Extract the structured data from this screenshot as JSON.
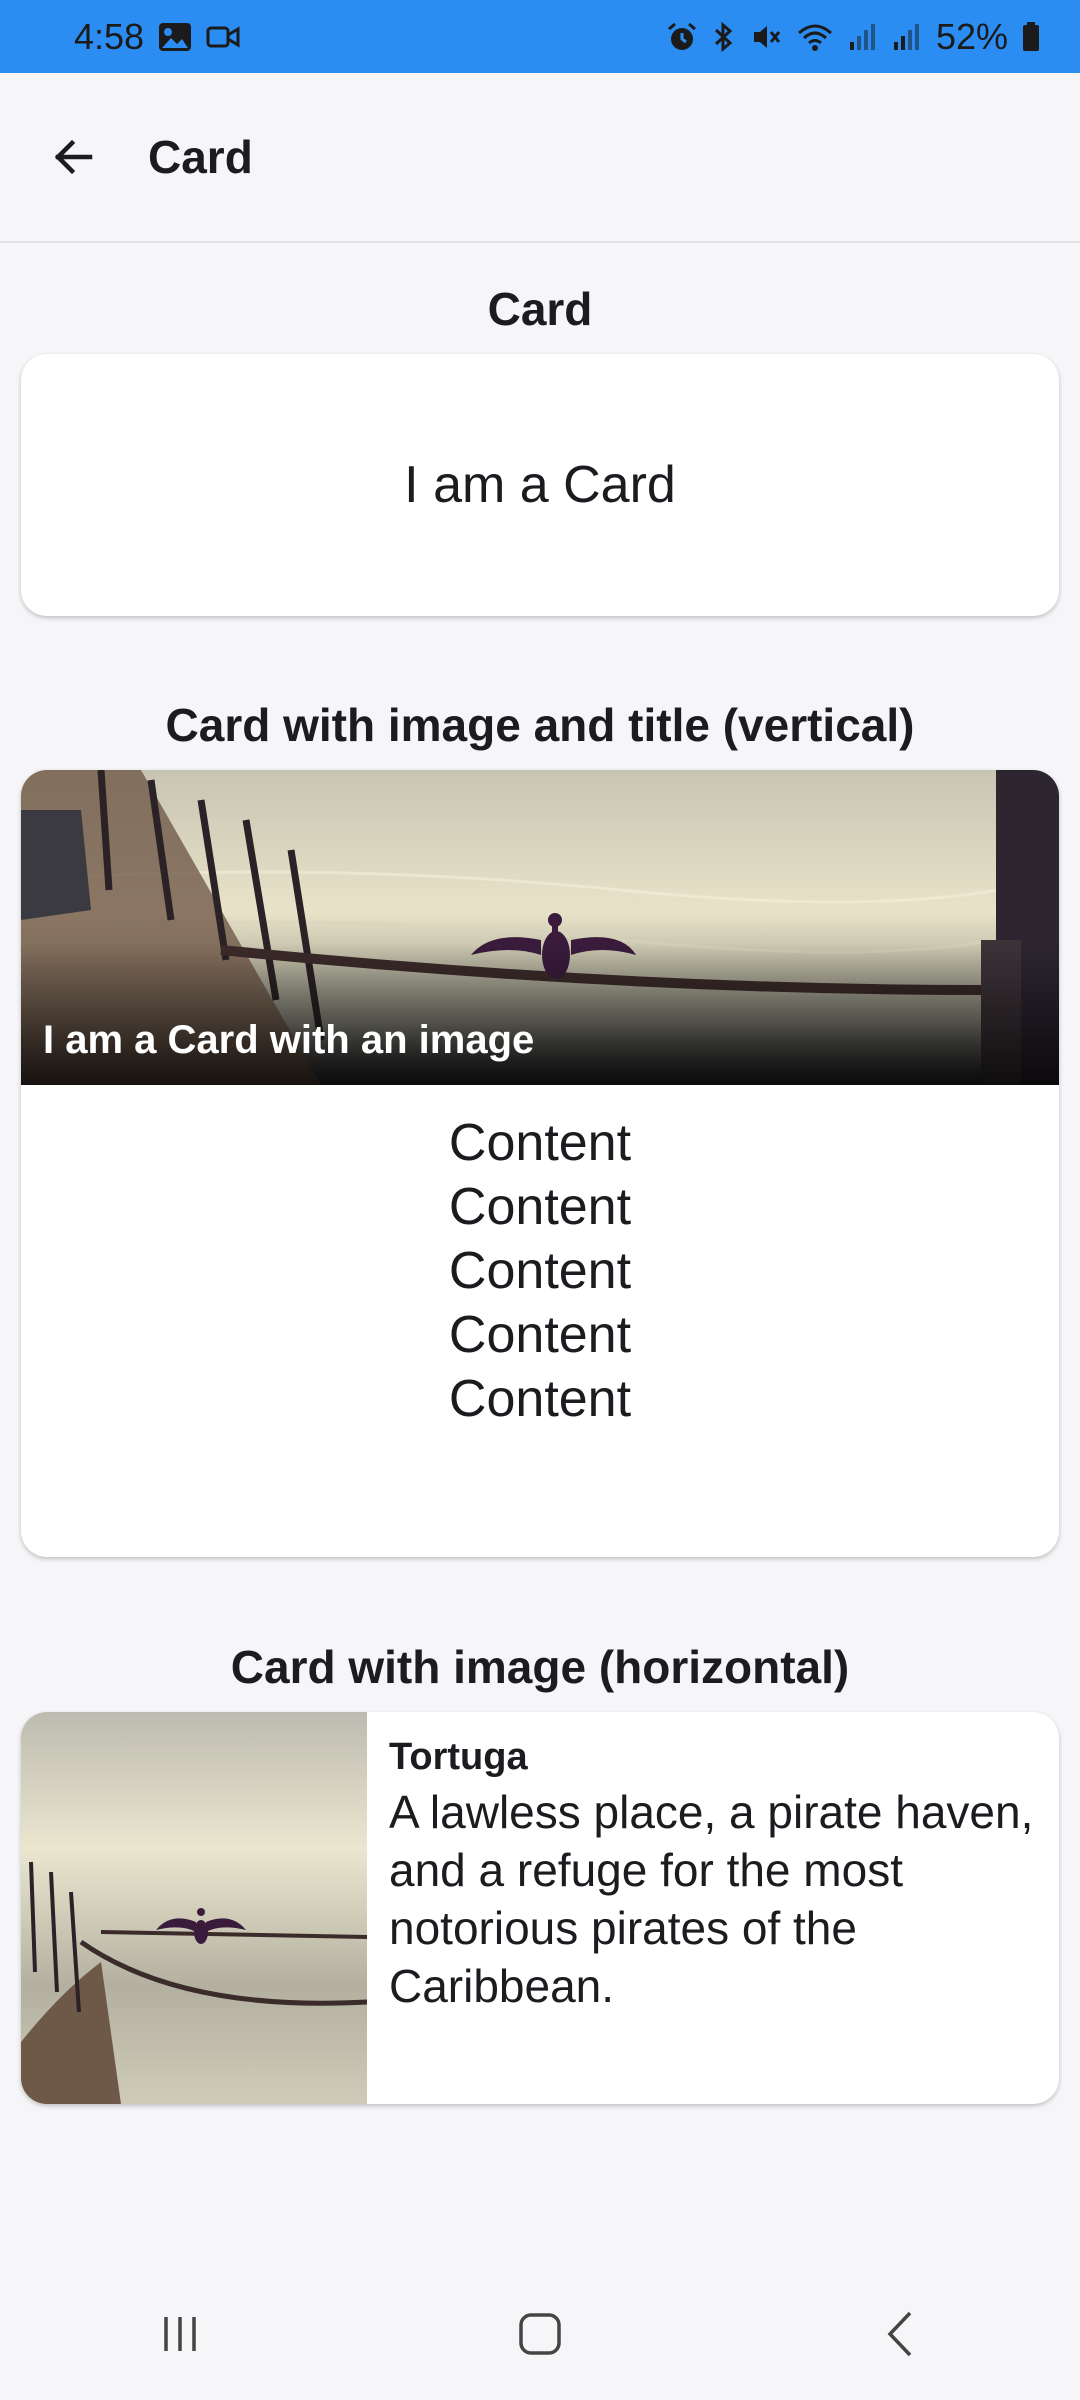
{
  "status_bar": {
    "time": "4:58",
    "battery": "52%",
    "left_icons": [
      "image-icon",
      "video-icon"
    ],
    "right_icons": [
      "alarm-icon",
      "bluetooth-icon",
      "mute-icon",
      "wifi-icon",
      "signal-icon",
      "signal-icon",
      "battery-icon"
    ]
  },
  "appbar": {
    "title": "Card",
    "back_icon": "arrow-left-icon"
  },
  "sections": {
    "basic": {
      "title": "Card",
      "card_text": "I am a Card"
    },
    "vertical": {
      "title": "Card with image and title (vertical)",
      "image_caption": "I am a Card with an image",
      "content": [
        "Content",
        "Content",
        "Content",
        "Content",
        "Content"
      ]
    },
    "horizontal": {
      "title": "Card with image (horizontal)",
      "card_title": "Tortuga",
      "card_description": "A lawless place, a pirate haven, and a refuge for the most notorious pirates of the Caribbean."
    }
  },
  "navbar": {
    "items": [
      "recent-apps-icon",
      "home-icon",
      "back-icon"
    ]
  },
  "colors": {
    "status_bar": "#2b8cf2",
    "background": "#f6f6f8",
    "card": "#ffffff",
    "text": "#1c1b1f"
  }
}
